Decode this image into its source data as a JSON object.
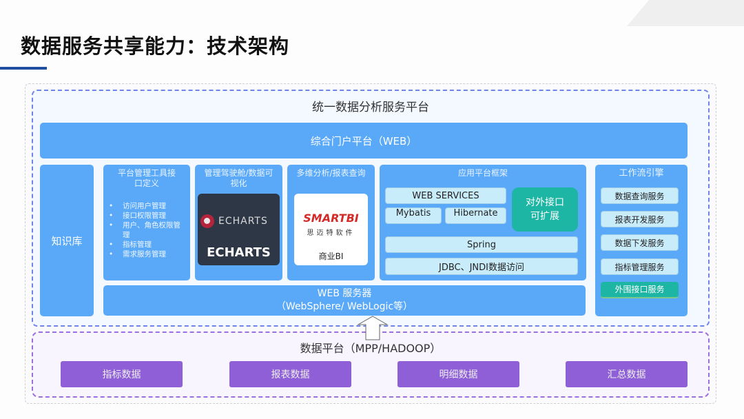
{
  "page": {
    "title": "数据服务共享能力：技术架构"
  },
  "platform": {
    "title": "统一数据分析服务平台",
    "portal": "综合门户平台（WEB）",
    "knowledge_base": "知识库",
    "tools": {
      "heading": "平台管理工具接口定义",
      "items": [
        "访问用户管理",
        "接口权限管理",
        "用户、角色权限管理",
        "指标管理",
        "需求服务管理"
      ]
    },
    "cockpit": {
      "heading": "管理驾驶舱/数据可视化",
      "logo_text": "ECHARTS",
      "label": "ECHARTS"
    },
    "analysis": {
      "heading": "多维分析/报表查询",
      "logo_text": "SMARTBI",
      "logo_sub": "思迈特软件",
      "label": "商业BI"
    },
    "app_framework": {
      "heading": "应用平台框架",
      "web_services": "WEB SERVICES",
      "mybatis": "Mybatis",
      "hibernate": "Hibernate",
      "extensible": "对外接口可扩展",
      "spring": "Spring",
      "jdbc": "JDBC、JNDI数据访问"
    },
    "workflow": {
      "heading": "工作流引擎",
      "items": [
        "数据查询服务",
        "报表开发服务",
        "数据下发服务",
        "指标管理服务",
        "外围接口服务"
      ]
    },
    "web_server": {
      "line1": "WEB 服务器",
      "line2": "（WebSphere/ WebLogic等）"
    }
  },
  "data_platform": {
    "title": "数据平台（MPP/HADOOP）",
    "items": [
      "指标数据",
      "报表数据",
      "明细数据",
      "汇总数据"
    ]
  },
  "colors": {
    "primary_blue": "#5aa9f9",
    "teal": "#1db5a3",
    "purple": "#8e5fd6",
    "title_bar": "#1f4ea3"
  }
}
